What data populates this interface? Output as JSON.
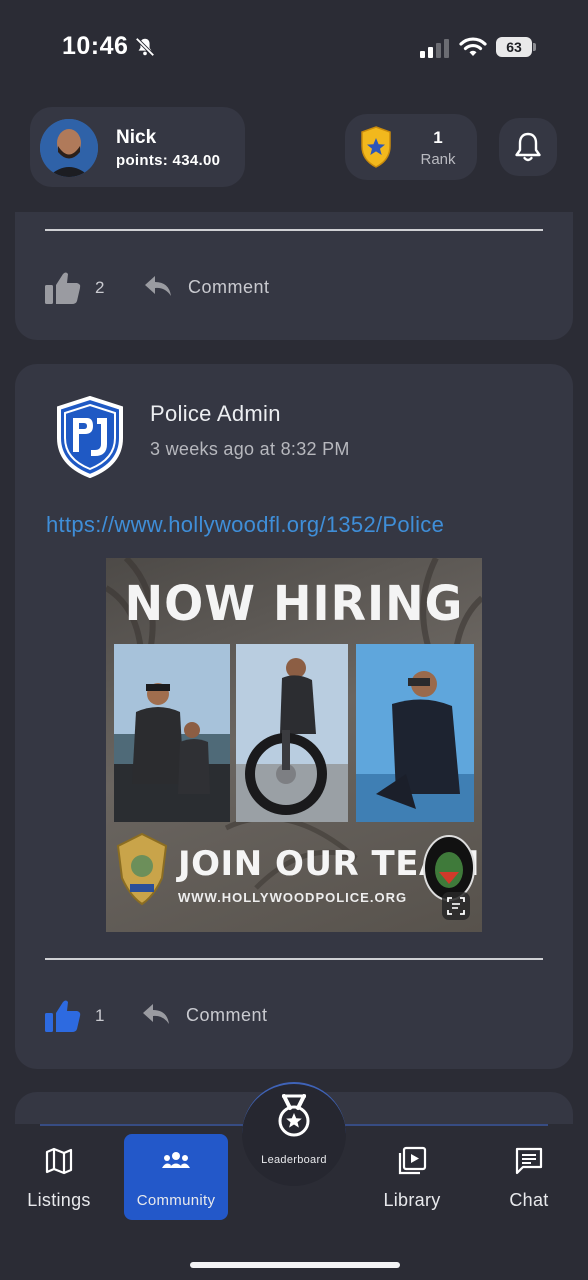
{
  "status_bar": {
    "time": "10:46",
    "battery": "63"
  },
  "header": {
    "user": {
      "name": "Nick",
      "points": "points: 434.00"
    },
    "rank": {
      "number": "1",
      "label": "Rank"
    }
  },
  "feed": {
    "previous_post": {
      "like_count": "2",
      "comment_label": "Comment"
    },
    "post": {
      "author": "Police Admin",
      "time": "3 weeks ago at 8:32 PM",
      "link": "https://www.hollywoodfl.org/1352/Police",
      "image": {
        "headline": "NOW HIRING",
        "cta": "JOIN OUR TEAM",
        "site": "WWW.HOLLYWOODPOLICE.ORG"
      },
      "like_count": "1",
      "comment_label": "Comment"
    }
  },
  "bottom_nav": {
    "items": [
      {
        "label": "Listings"
      },
      {
        "label": "Community"
      },
      {
        "label": "Leaderboard"
      },
      {
        "label": "Library"
      },
      {
        "label": "Chat"
      }
    ],
    "active": "Community"
  },
  "colors": {
    "accent": "#2358c9",
    "link": "#3f8ed8",
    "background": "#2b2c35",
    "card": "#353743"
  },
  "icons": [
    "bell-off-icon",
    "signal-icon",
    "wifi-icon",
    "battery-icon",
    "sheriff-badge-icon",
    "bell-icon",
    "thumbs-up-icon",
    "reply-icon",
    "map-icon",
    "people-icon",
    "medal-icon",
    "video-library-icon",
    "chat-icon"
  ]
}
